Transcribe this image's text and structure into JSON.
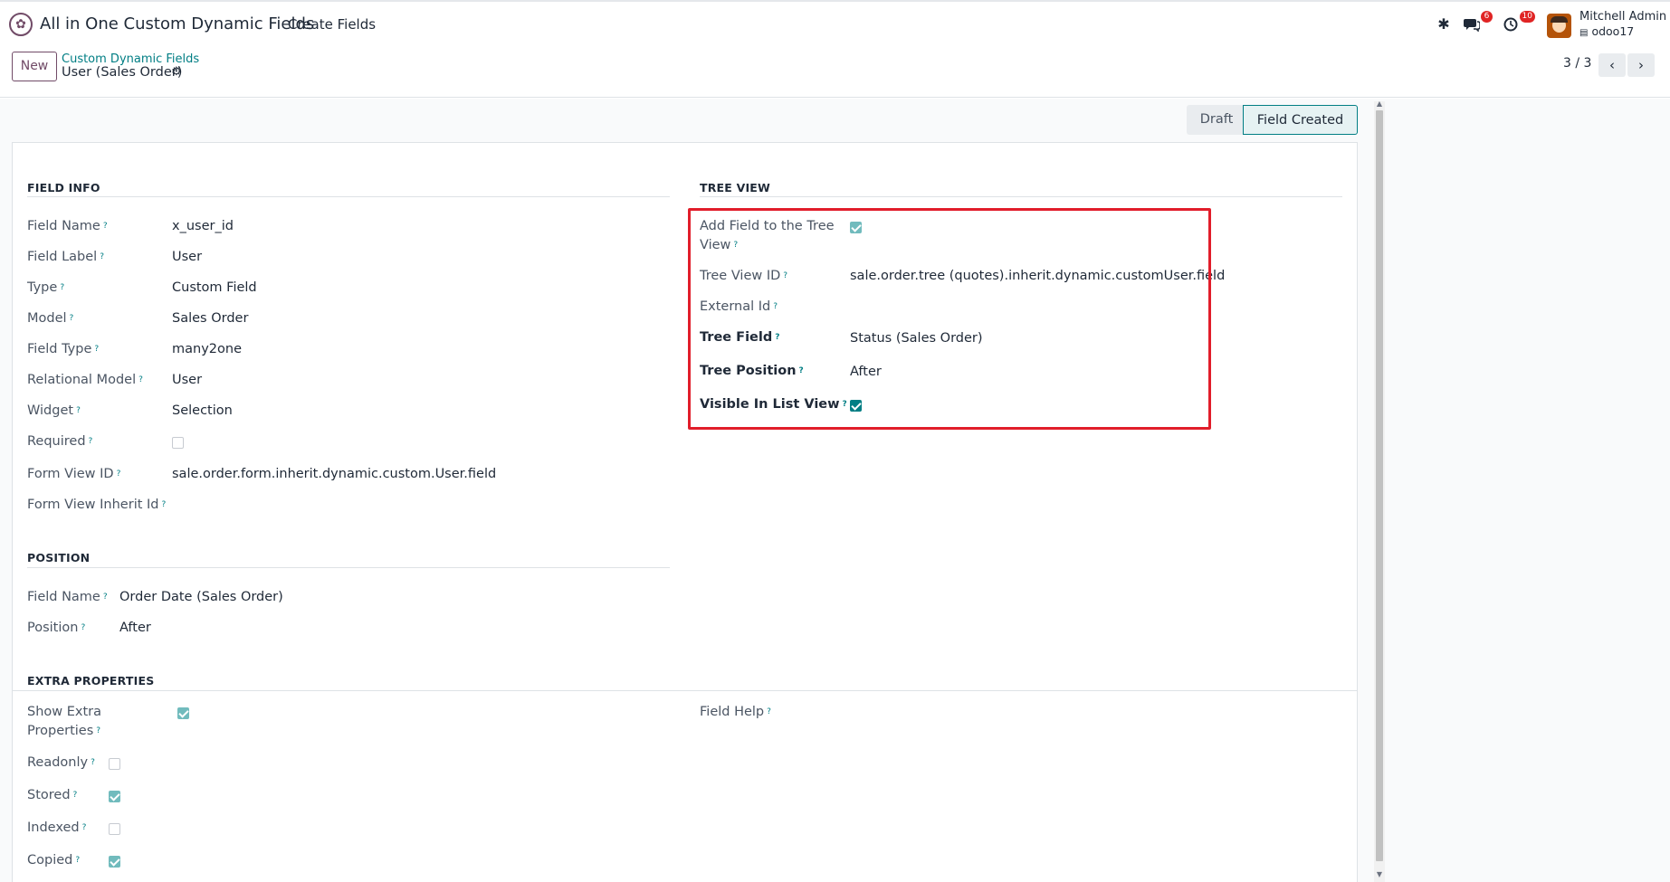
{
  "navbar": {
    "app_name": "All in One Custom Dynamic Fields",
    "menu_create": "Create Fields",
    "messages_count": "6",
    "activities_count": "10",
    "user_name": "Mitchell Admin",
    "user_db": "odoo17"
  },
  "control_panel": {
    "new_label": "New",
    "breadcrumb_parent": "Custom Dynamic Fields",
    "breadcrumb_current": "User (Sales Order)",
    "pager_value": "3 / 3"
  },
  "statusbar": {
    "stages": [
      "Draft",
      "Field Created"
    ],
    "active": "Field Created"
  },
  "field_info": {
    "title": "FIELD INFO",
    "rows": [
      {
        "label": "Field Name",
        "value": "x_user_id"
      },
      {
        "label": "Field Label",
        "value": "User"
      },
      {
        "label": "Type",
        "value": "Custom Field"
      },
      {
        "label": "Model",
        "value": "Sales Order"
      },
      {
        "label": "Field Type",
        "value": "many2one"
      },
      {
        "label": "Relational Model",
        "value": "User"
      },
      {
        "label": "Widget",
        "value": "Selection"
      },
      {
        "label": "Required",
        "checked": false
      },
      {
        "label": "Form View ID",
        "value": "sale.order.form.inherit.dynamic.custom.User.field"
      },
      {
        "label": "Form View Inherit Id",
        "value": ""
      }
    ]
  },
  "tree_view": {
    "title": "TREE VIEW",
    "add_field_label": "Add Field to the Tree View",
    "add_field_checked": true,
    "tree_view_id_label": "Tree View ID",
    "tree_view_id_value": "sale.order.tree (quotes).inherit.dynamic.customUser.field",
    "external_id_label": "External Id",
    "tree_field_label": "Tree Field",
    "tree_field_value": "Status (Sales Order)",
    "tree_position_label": "Tree Position",
    "tree_position_value": "After",
    "visible_label": "Visible In List View",
    "visible_checked": true
  },
  "position": {
    "title": "POSITION",
    "field_name_label": "Field Name",
    "field_name_value": "Order Date (Sales Order)",
    "position_label": "Position",
    "position_value": "After"
  },
  "extra_properties": {
    "title": "EXTRA PROPERTIES",
    "show_extra_label": "Show Extra Properties",
    "show_extra_checked": true,
    "field_help_label": "Field Help",
    "readonly_label": "Readonly",
    "readonly_checked": false,
    "stored_label": "Stored",
    "stored_checked": true,
    "indexed_label": "Indexed",
    "indexed_checked": false,
    "copied_label": "Copied",
    "copied_checked": true
  },
  "colors": {
    "brand": "#714b67",
    "accent": "#017e84",
    "highlight": "#e11d2a"
  }
}
